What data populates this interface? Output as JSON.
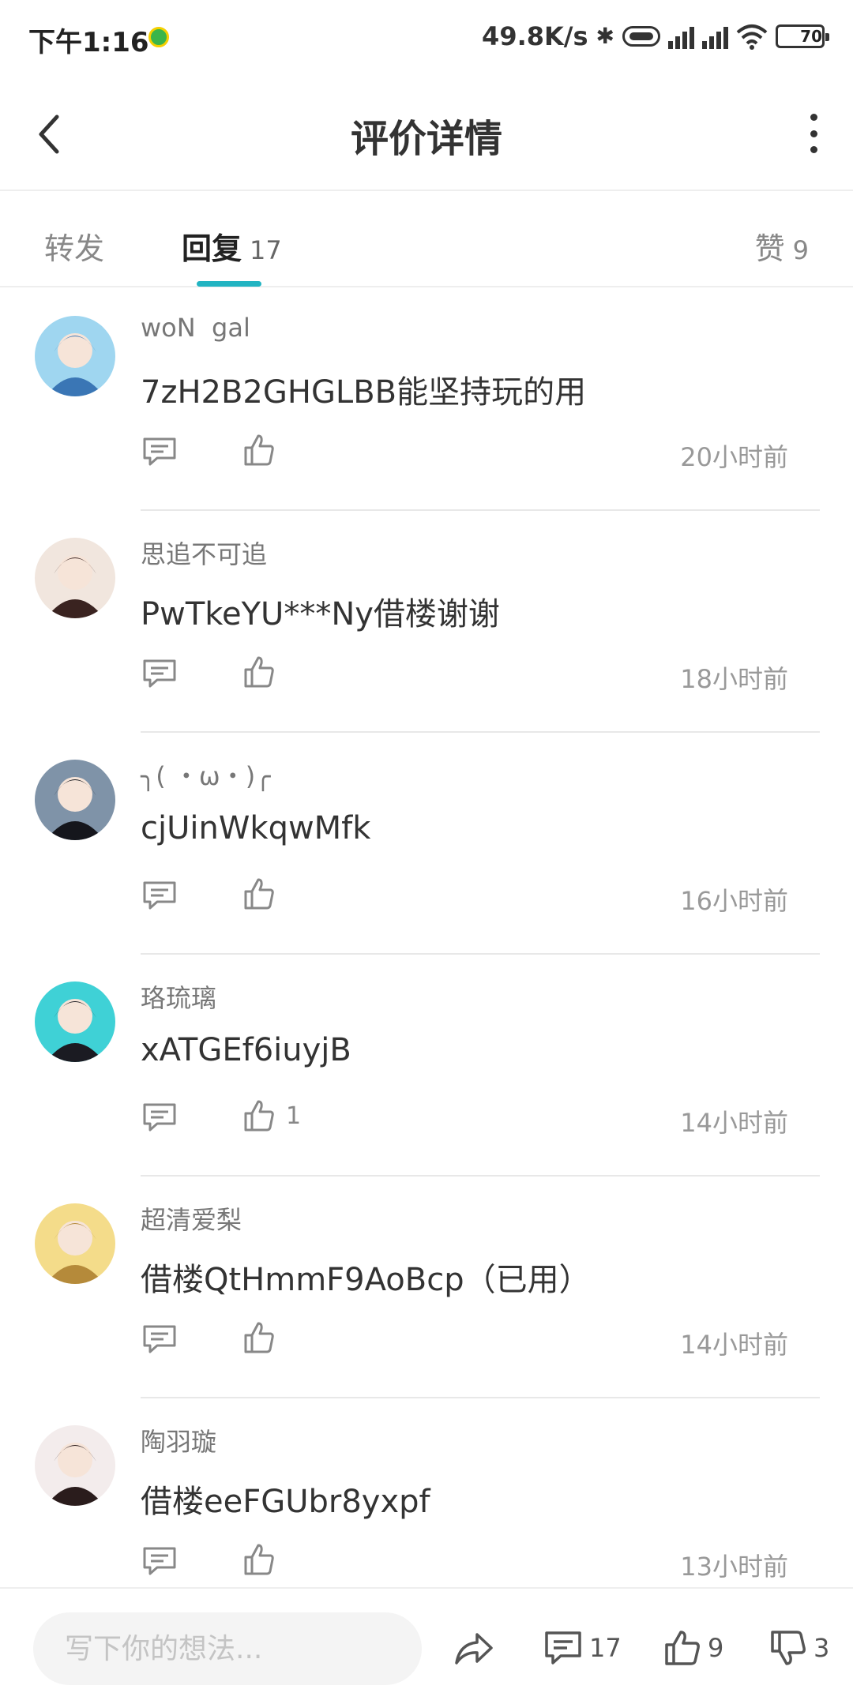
{
  "status_bar": {
    "time": "下午1:16",
    "net_speed": "49.8K/s",
    "battery": "70"
  },
  "header": {
    "title": "评价详情"
  },
  "tabs": {
    "forward": "转发",
    "reply": "回复",
    "reply_count": "17",
    "like": "赞",
    "like_count": "9"
  },
  "comments": [
    {
      "name": "woN  gal",
      "content": "7zH2B2GHGLBB能坚持玩的用",
      "likes": "",
      "time": "20小时前",
      "avatar_colors": [
        "#9fd6f0",
        "#3a76b5"
      ]
    },
    {
      "name": "思追不可追",
      "content": "PwTkeYU***Ny借楼谢谢",
      "likes": "",
      "time": "18小时前",
      "avatar_colors": [
        "#f1e6de",
        "#3a2320"
      ]
    },
    {
      "name": "╮( ・ω・)╭",
      "content": "cjUinWkqwMfk",
      "likes": "",
      "time": "16小时前",
      "avatar_colors": [
        "#7f93a8",
        "#15161c"
      ]
    },
    {
      "name": "珞琉璃",
      "content": "xATGEf6iuyjB",
      "likes": "1",
      "time": "14小时前",
      "avatar_colors": [
        "#3fd1d6",
        "#1b1b22"
      ]
    },
    {
      "name": "超清爱梨",
      "content": "借楼QtHmmF9AoBcp（已用）",
      "likes": "",
      "time": "14小时前",
      "avatar_colors": [
        "#f4dc8a",
        "#b58a3a"
      ]
    },
    {
      "name": "陶羽璇",
      "content": "借楼eeFGUbr8yxpf",
      "likes": "",
      "time": "13小时前",
      "avatar_colors": [
        "#f3ecec",
        "#2a1c1c"
      ]
    }
  ],
  "bottom_bar": {
    "placeholder": "写下你的想法...",
    "comment_count": "17",
    "like_count": "9",
    "dislike_count": "3"
  }
}
